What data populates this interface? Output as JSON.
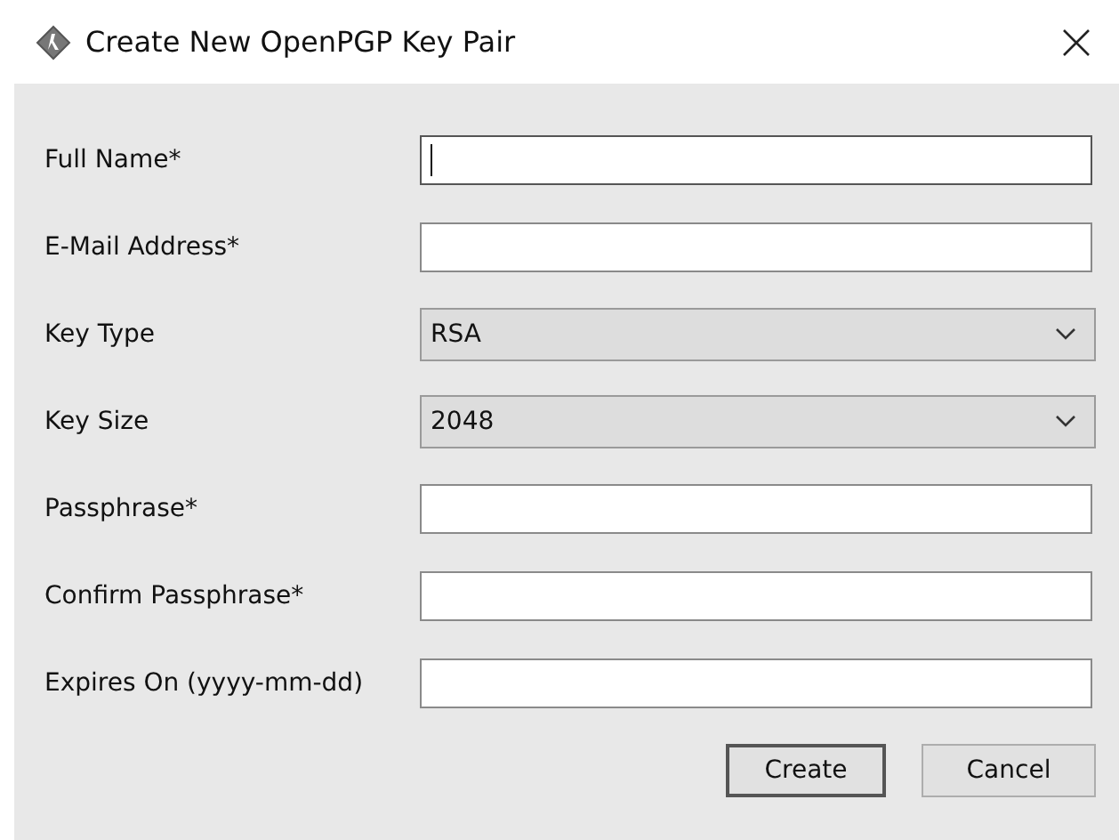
{
  "window": {
    "title": "Create New OpenPGP Key Pair"
  },
  "fields": [
    {
      "label": "Full Name*",
      "kind": "text",
      "focused": true
    },
    {
      "label": "E-Mail Address*",
      "kind": "text",
      "focused": false
    },
    {
      "label": "Key Type",
      "kind": "select",
      "value": "RSA"
    },
    {
      "label": "Key Size",
      "kind": "select",
      "value": "2048"
    },
    {
      "label": "Passphrase*",
      "kind": "text",
      "focused": false
    },
    {
      "label": "Confirm Passphrase*",
      "kind": "text",
      "focused": false
    },
    {
      "label": "Expires On (yyyy-mm-dd)",
      "kind": "text",
      "focused": false
    }
  ],
  "buttons": [
    {
      "label": "Create",
      "default": true
    },
    {
      "label": "Cancel",
      "default": false
    }
  ]
}
